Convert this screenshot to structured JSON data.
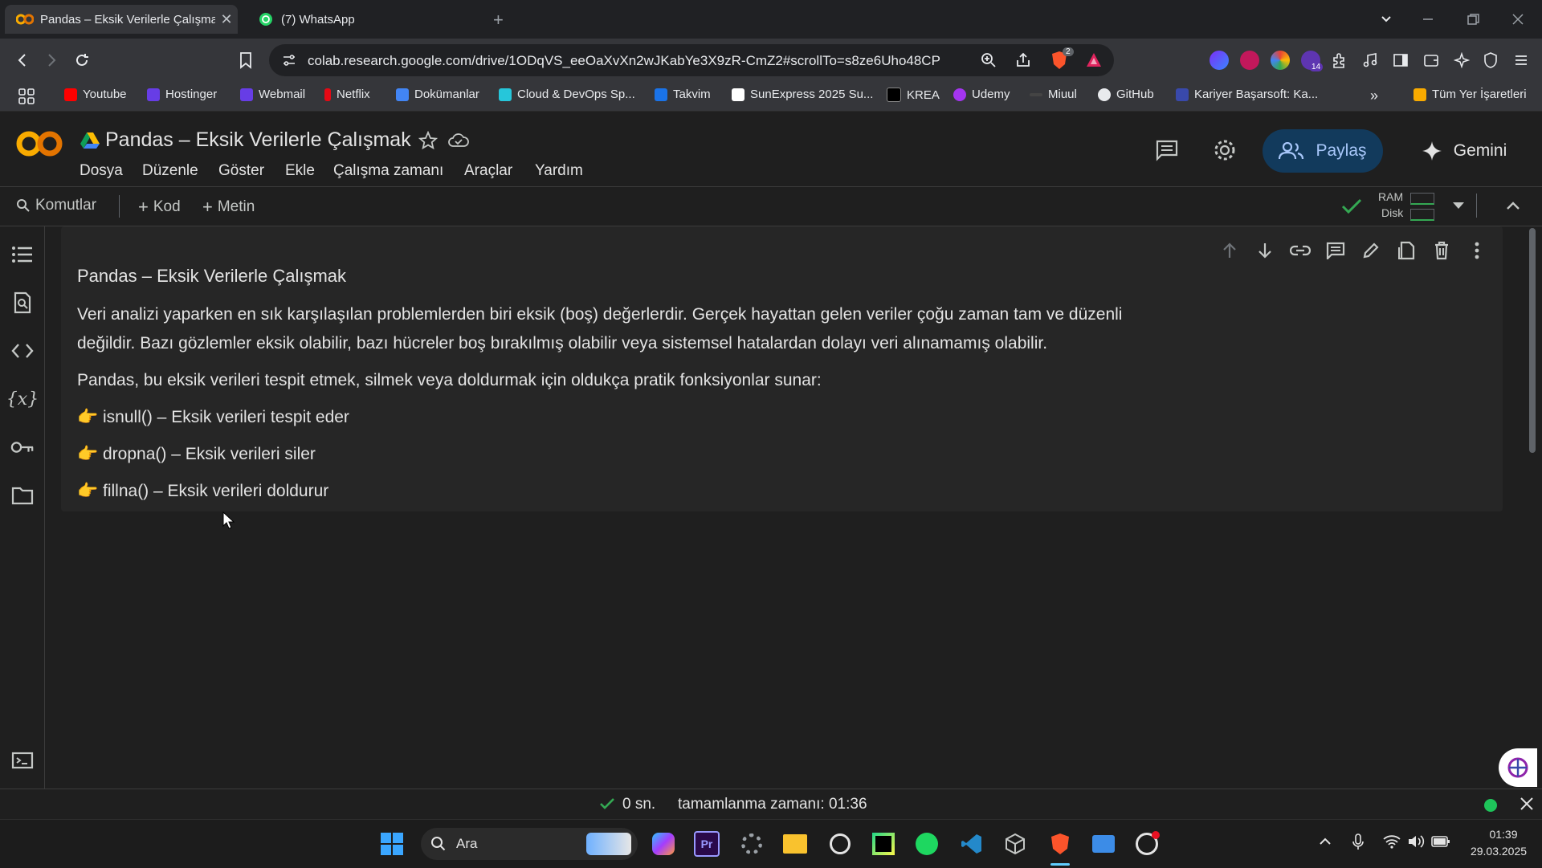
{
  "browser": {
    "tabs": [
      {
        "title": "Pandas – Eksik Verilerle Çalışma",
        "active": true
      },
      {
        "title": "(7) WhatsApp",
        "active": false
      }
    ],
    "new_tab": "+",
    "url": "colab.research.google.com/drive/1ODqVS_eeOaXvXn2wJKabYe3X9zR-CmZ2#scrollTo=s8ze6Uho48CP",
    "brave_badge": "2",
    "ext_badge": "14"
  },
  "bookmarks": {
    "items": [
      "Youtube",
      "Hostinger",
      "Webmail",
      "Netflix",
      "Dokümanlar",
      "Cloud & DevOps Sp...",
      "Takvim",
      "SunExpress 2025 Su...",
      "KREA",
      "Udemy",
      "Miuul",
      "GitHub",
      "Kariyer Başarsoft: Ka..."
    ],
    "more": "»",
    "all": "Tüm Yer İşaretleri"
  },
  "colab": {
    "logo": "CO",
    "title": "Pandas – Eksik Verilerle Çalışmak",
    "menu": [
      "Dosya",
      "Düzenle",
      "Göster",
      "Ekle",
      "Çalışma zamanı",
      "Araçlar",
      "Yardım"
    ],
    "share": "Paylaş",
    "gemini": "Gemini"
  },
  "toolbar": {
    "commands": "Komutlar",
    "add_code": "Kod",
    "add_text": "Metin",
    "ram": "RAM",
    "disk": "Disk"
  },
  "cell": {
    "heading": "Pandas – Eksik Verilerle Çalışmak",
    "para1_line1": "Veri analizi yaparken en sık karşılaşılan problemlerden biri eksik (boş) değerlerdir. Gerçek hayattan gelen veriler çoğu zaman tam ve düzenli",
    "para1_line2": "değildir. Bazı gözlemler eksik olabilir, bazı hücreler boş bırakılmış olabilir veya sistemsel hatalardan dolayı veri alınamamış olabilir.",
    "para2": "Pandas, bu eksik verileri tespit etmek, silmek veya doldurmak için oldukça pratik fonksiyonlar sunar:",
    "bullets": [
      "isnull() – Eksik verileri tespit eder",
      "dropna() – Eksik verileri siler",
      "fillna() – Eksik verileri doldurur"
    ],
    "bullet_glyph": "👉"
  },
  "status": {
    "elapsed": "0 sn.",
    "completed": "tamamlanma zamanı: 01:36"
  },
  "taskbar": {
    "search": "Ara",
    "time": "01:39",
    "date": "29.03.2025"
  },
  "colors": {
    "accent": "#a8c7fa",
    "share_bg": "#123a5c",
    "ok_green": "#34a853",
    "colab_orange": "#f9ab00"
  }
}
